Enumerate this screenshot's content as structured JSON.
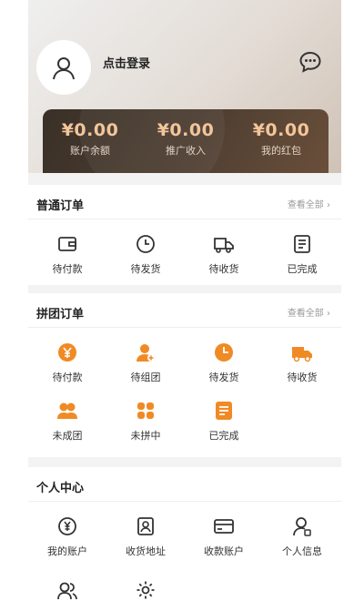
{
  "header": {
    "login_label": "点击登录",
    "stats": [
      {
        "value": "¥0.00",
        "label": "账户余额"
      },
      {
        "value": "¥0.00",
        "label": "推广收入"
      },
      {
        "value": "¥0.00",
        "label": "我的红包"
      }
    ]
  },
  "normal_orders": {
    "title": "普通订单",
    "view_all": "查看全部",
    "items": [
      {
        "label": "待付款",
        "icon": "wallet-icon"
      },
      {
        "label": "待发货",
        "icon": "clock-icon"
      },
      {
        "label": "待收货",
        "icon": "truck-icon"
      },
      {
        "label": "已完成",
        "icon": "receipt-icon"
      }
    ]
  },
  "group_orders": {
    "title": "拼团订单",
    "view_all": "查看全部",
    "items": [
      {
        "label": "待付款",
        "icon": "yen-coin-icon"
      },
      {
        "label": "待组团",
        "icon": "add-user-icon"
      },
      {
        "label": "待发货",
        "icon": "clock-icon"
      },
      {
        "label": "待收货",
        "icon": "truck-icon"
      },
      {
        "label": "未成团",
        "icon": "users-icon"
      },
      {
        "label": "未拼中",
        "icon": "grid-icon"
      },
      {
        "label": "已完成",
        "icon": "receipt-icon"
      }
    ]
  },
  "personal_center": {
    "title": "个人中心",
    "items": [
      {
        "label": "我的账户",
        "icon": "account-icon"
      },
      {
        "label": "收货地址",
        "icon": "address-icon"
      },
      {
        "label": "收款账户",
        "icon": "card-icon"
      },
      {
        "label": "个人信息",
        "icon": "profile-icon"
      },
      {
        "label": "",
        "icon": "team-icon"
      },
      {
        "label": "",
        "icon": "settings-icon"
      }
    ]
  },
  "colors": {
    "accent": "#f08a24",
    "card": "#3f342b",
    "gold": "#f2c59a"
  }
}
